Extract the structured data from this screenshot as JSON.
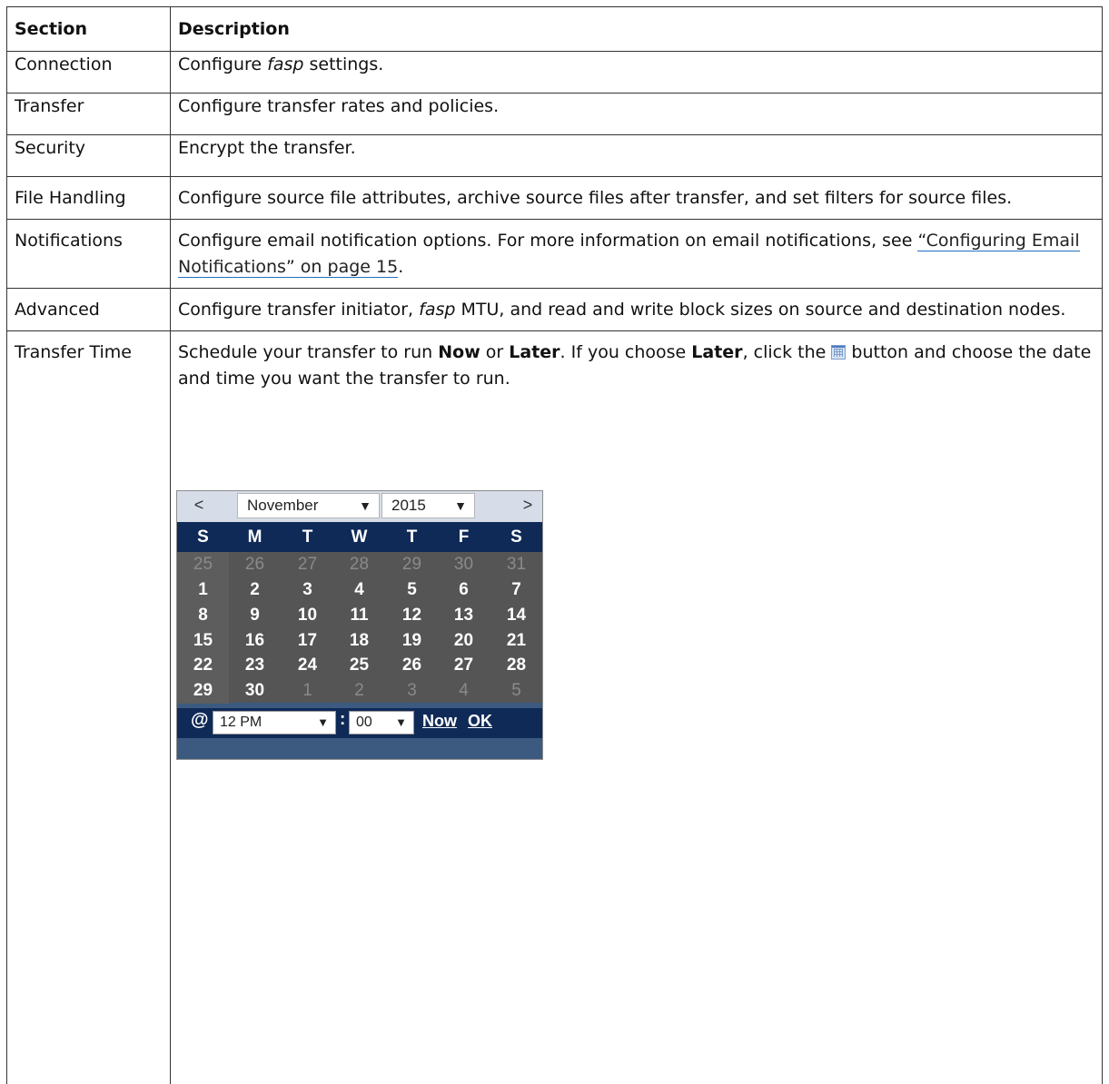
{
  "table": {
    "headers": [
      "Section",
      "Description"
    ],
    "rows": [
      {
        "section": "Connection",
        "pre": "Configure ",
        "em": "fasp",
        "post": " settings."
      },
      {
        "section": "Transfer",
        "text": "Configure transfer rates and policies."
      },
      {
        "section": "Security",
        "text": "Encrypt the transfer."
      },
      {
        "section": "File Handling",
        "text": "Configure source file attributes, archive source files after transfer, and set filters for source files."
      },
      {
        "section": "Notifications",
        "text": "Configure email notification options. For more information on email notifications, see ",
        "link": "“Configuring Email Notifications” on page 15",
        "end": "."
      },
      {
        "section": "Advanced",
        "pre": "Configure transfer initiator, ",
        "em": "fasp",
        "post": " MTU, and read and write block sizes on source and destination nodes."
      },
      {
        "section": "Transfer Time",
        "t1": "Schedule your transfer to run ",
        "b1": "Now",
        "t2": " or ",
        "b2": "Later",
        "t3": ". If you choose ",
        "b3": "Later",
        "t4": ", click the ",
        "t5": " button and choose the date and time you want the transfer to run."
      }
    ]
  },
  "calendar": {
    "prev": "<",
    "next": ">",
    "month": "November",
    "year": "2015",
    "weekdays": [
      "S",
      "M",
      "T",
      "W",
      "T",
      "F",
      "S"
    ],
    "weeks": [
      [
        "25",
        "26",
        "27",
        "28",
        "29",
        "30",
        "31"
      ],
      [
        "1",
        "2",
        "3",
        "4",
        "5",
        "6",
        "7"
      ],
      [
        "8",
        "9",
        "10",
        "11",
        "12",
        "13",
        "14"
      ],
      [
        "15",
        "16",
        "17",
        "18",
        "19",
        "20",
        "21"
      ],
      [
        "22",
        "23",
        "24",
        "25",
        "26",
        "27",
        "28"
      ],
      [
        "29",
        "30",
        "1",
        "2",
        "3",
        "4",
        "5"
      ]
    ],
    "at": "@",
    "hour": "12 PM",
    "colon": ":",
    "minute": "00",
    "now_label": "Now",
    "ok_label": "OK",
    "dropdown_arrow": "▼",
    "icon": "calendar-icon"
  }
}
